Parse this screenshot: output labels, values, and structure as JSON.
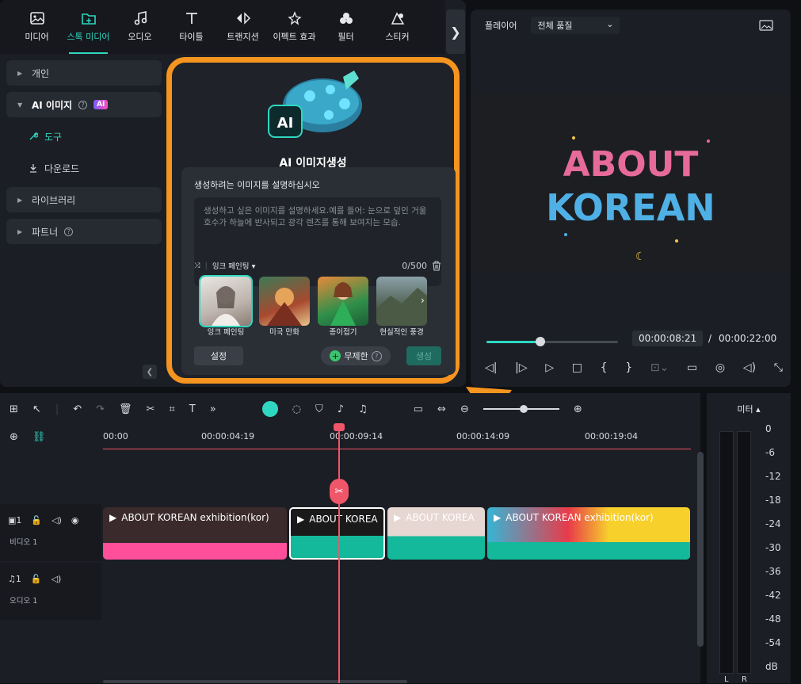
{
  "toolbar": {
    "items": [
      {
        "label": "미디어",
        "icon": "image-icon"
      },
      {
        "label": "스톡 미디어",
        "icon": "cloud-folder-icon"
      },
      {
        "label": "오디오",
        "icon": "music-note-icon"
      },
      {
        "label": "타이틀",
        "icon": "text-t-icon"
      },
      {
        "label": "트랜지션",
        "icon": "transition-icon"
      },
      {
        "label": "이펙트 효과",
        "icon": "effects-icon"
      },
      {
        "label": "필터",
        "icon": "filter-icon"
      },
      {
        "label": "스티커",
        "icon": "sticker-icon"
      }
    ],
    "more": "❯"
  },
  "sidebar": {
    "personal": "개인",
    "ai_image": "AI 이미지",
    "ai_badge": "AI",
    "tools": "도구",
    "download": "다운로드",
    "library": "라이브러리",
    "partner": "파트너"
  },
  "aicard": {
    "logo_text": "AI",
    "title": "AI 이미지생성",
    "prompt_label": "생성하려는 이미지를 설명하십시오",
    "placeholder": "생성하고 싶은 이미지를 설명하세요.예를 들어: 눈으로 덮인 거울 호수가 하늘에 반사되고 광각 렌즈를 통해 보여지는 모습.",
    "style": "잉크 페인팅",
    "counter": "0/500",
    "thumbs": [
      "잉크 페인팅",
      "미국 만화",
      "종이접기",
      "현실적인 풍경"
    ],
    "settings": "설정",
    "unlimited": "무제한",
    "generate": "생성"
  },
  "player": {
    "label": "플레이어",
    "quality": "전체 품질",
    "current": "00:00:08:21",
    "separator": "/",
    "total": "00:00:22:00",
    "title_line1": "ABOUT",
    "title_line2": "KOREAN",
    "progress": 0.41
  },
  "timeline": {
    "ruler": [
      "00:00",
      "00:00:04:19",
      "00:00:09:14",
      "00:00:14:09",
      "00:00:19:04"
    ],
    "video_track": "비디오 1",
    "audio_track": "오디오 1",
    "track_num": "1",
    "clips": [
      "ABOUT KOREAN exhibition(kor)",
      "ABOUT KOREA",
      "ABOUT KOREA",
      "ABOUT KOREAN exhibition(kor)"
    ]
  },
  "meter": {
    "label": "미터 ▴",
    "scale": [
      "0",
      "-6",
      "-12",
      "-18",
      "-24",
      "-30",
      "-36",
      "-42",
      "-48",
      "-54",
      "dB"
    ],
    "left": "L",
    "right": "R"
  }
}
